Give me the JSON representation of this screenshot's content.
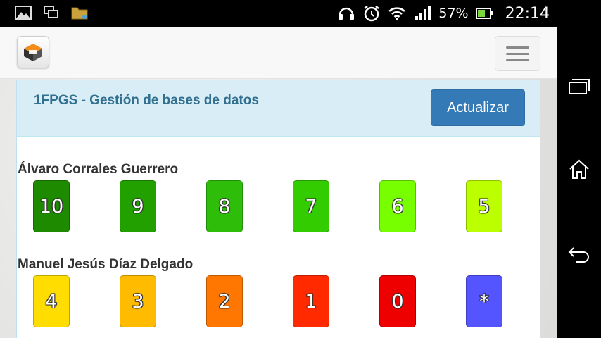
{
  "status_bar": {
    "left_icons": [
      "gallery-icon",
      "screen-mirror-icon",
      "folder-icon"
    ],
    "right_icons": [
      "headset-icon",
      "alarm-icon",
      "wifi-icon",
      "signal-icon",
      "battery-icon"
    ],
    "battery": "57%",
    "time": "22:14"
  },
  "nav_bar": {
    "buttons": [
      "recent-apps-icon",
      "home-icon",
      "back-icon"
    ]
  },
  "header": {
    "logo_icon": "app-logo-icon",
    "menu_icon": "hamburger-menu-icon"
  },
  "panel": {
    "title": "1FPGS - Gestión de bases de datos",
    "update_button": "Actualizar"
  },
  "students": [
    {
      "name": "Álvaro Corrales Guerrero",
      "grades": [
        {
          "label": "10",
          "color": "#1e8a00"
        },
        {
          "label": "9",
          "color": "#22a000"
        },
        {
          "label": "8",
          "color": "#2ebe0a"
        },
        {
          "label": "7",
          "color": "#33cc00"
        },
        {
          "label": "6",
          "color": "#77ff00"
        },
        {
          "label": "5",
          "color": "#bbff00"
        }
      ]
    },
    {
      "name": "Manuel Jesús Díaz Delgado",
      "grades": [
        {
          "label": "4",
          "color": "#ffdd00"
        },
        {
          "label": "3",
          "color": "#ffbb00"
        },
        {
          "label": "2",
          "color": "#ff7700"
        },
        {
          "label": "1",
          "color": "#ff2a00"
        },
        {
          "label": "0",
          "color": "#ee0000"
        },
        {
          "label": "*",
          "color": "#5555ff"
        }
      ]
    }
  ]
}
